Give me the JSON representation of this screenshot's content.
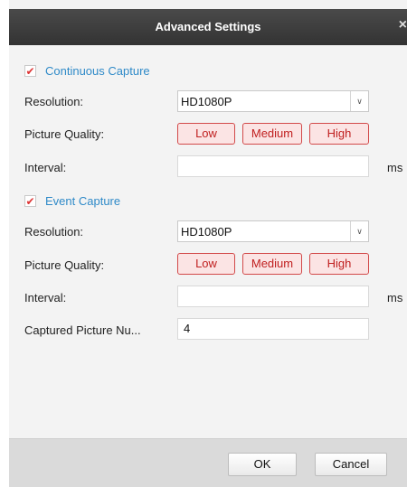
{
  "dialog": {
    "title": "Advanced Settings",
    "close_glyph": "×",
    "close_icon": "close-icon"
  },
  "continuous": {
    "label": "Continuous Capture",
    "checked": true,
    "check_glyph": "✔",
    "resolution_label": "Resolution:",
    "resolution_value": "HD1080P",
    "dropdown_glyph": "∨",
    "quality_label": "Picture Quality:",
    "quality_options": [
      "Low",
      "Medium",
      "High"
    ],
    "interval_label": "Interval:",
    "interval_value": "",
    "interval_unit": "ms"
  },
  "event": {
    "label": "Event Capture",
    "checked": true,
    "check_glyph": "✔",
    "resolution_label": "Resolution:",
    "resolution_value": "HD1080P",
    "dropdown_glyph": "∨",
    "quality_label": "Picture Quality:",
    "quality_options": [
      "Low",
      "Medium",
      "High"
    ],
    "interval_label": "Interval:",
    "interval_value": "",
    "interval_unit": "ms",
    "captured_label": "Captured Picture Nu...",
    "captured_value": "4"
  },
  "footer": {
    "ok_label": "OK",
    "cancel_label": "Cancel"
  },
  "colors": {
    "section_accent": "#2f8ac8",
    "quality_button_border": "#d24a4a",
    "quality_button_bg": "#fbe4e4",
    "check_mark": "#dd3333"
  }
}
